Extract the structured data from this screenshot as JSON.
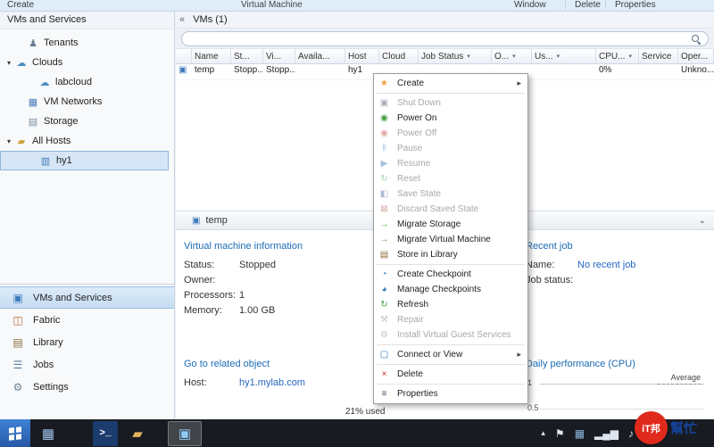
{
  "titlebar": {
    "create": "Create",
    "title": "Virtual Machine",
    "window": "Window",
    "delete": "Delete",
    "properties": "Properties"
  },
  "icons": {
    "collapse_pane": "«",
    "details_expand": "⌄",
    "tray_expand": "▴"
  },
  "sidebar": {
    "header": "VMs and Services",
    "tree": [
      {
        "label": "Tenants",
        "icon": "tenants",
        "glyph": "♟",
        "color": "#6b7f94",
        "indent": 1
      },
      {
        "label": "Clouds",
        "icon": "clouds",
        "glyph": "☁",
        "color": "#4a90c4",
        "indent": 0,
        "expander": "▾"
      },
      {
        "label": "labcloud",
        "icon": "cloud",
        "glyph": "☁",
        "color": "#4a90c4",
        "indent": 2
      },
      {
        "label": "VM Networks",
        "icon": "vm-networks",
        "glyph": "▦",
        "color": "#4a7fb5",
        "indent": 1
      },
      {
        "label": "Storage",
        "icon": "storage",
        "glyph": "▤",
        "color": "#7a8da0",
        "indent": 1
      },
      {
        "label": "All Hosts",
        "icon": "all-hosts-folder",
        "glyph": "▰",
        "color": "#c8a23c",
        "indent": 0,
        "expander": "▾"
      },
      {
        "label": "hy1",
        "icon": "host-server",
        "glyph": "▥",
        "color": "#3c7ab8",
        "indent": 2,
        "selected": true
      }
    ],
    "nav": [
      {
        "label": "VMs and Services",
        "icon": "vms-and-services",
        "glyph": "▣",
        "color": "#3c7ab8",
        "selected": true
      },
      {
        "label": "Fabric",
        "icon": "fabric",
        "glyph": "◫",
        "color": "#c06a3a"
      },
      {
        "label": "Library",
        "icon": "library",
        "glyph": "▤",
        "color": "#8a6d3b"
      },
      {
        "label": "Jobs",
        "icon": "jobs",
        "glyph": "☰",
        "color": "#5b7a9d"
      },
      {
        "label": "Settings",
        "icon": "settings",
        "glyph": "⚙",
        "color": "#6b7f94"
      }
    ]
  },
  "content": {
    "header": "VMs (1)",
    "search_value": "",
    "table": {
      "columns": [
        {
          "label": ""
        },
        {
          "label": "Name"
        },
        {
          "label": "St..."
        },
        {
          "label": "Vi..."
        },
        {
          "label": "Availa..."
        },
        {
          "label": "Host"
        },
        {
          "label": "Cloud"
        },
        {
          "label": "Job Status",
          "arrow": true
        },
        {
          "label": "O...",
          "arrow": true
        },
        {
          "label": "Us...",
          "arrow": true
        },
        {
          "label": "CPU...",
          "arrow": true
        },
        {
          "label": "Service"
        },
        {
          "label": "Oper..."
        }
      ],
      "row_cells": [
        {
          "icon": "vm",
          "glyph": "▣",
          "color": "#3c7ab8",
          "label": ""
        },
        {
          "label": "temp"
        },
        {
          "label": "Stopp..."
        },
        {
          "label": "Stopp..."
        },
        {
          "label": ""
        },
        {
          "label": "hy1"
        },
        {
          "label": ""
        },
        {
          "label": ""
        },
        {
          "label": ""
        },
        {
          "label": ""
        },
        {
          "label": "0%"
        },
        {
          "label": ""
        },
        {
          "label": "Unkno..."
        }
      ]
    },
    "details_tab": "temp",
    "vm_info": {
      "heading": "Virtual machine information",
      "fields": [
        {
          "label": "Status:",
          "value": "Stopped"
        },
        {
          "label": "Owner:",
          "value": ""
        },
        {
          "label": "Processors:",
          "value": "1"
        },
        {
          "label": "Memory:",
          "value": "1.00 GB"
        }
      ]
    },
    "related": {
      "heading": "Go to related object",
      "fields": [
        {
          "label": "Host:",
          "value": "hy1.mylab.com",
          "link": true
        }
      ]
    },
    "recent_job": {
      "heading": "Recent job",
      "fields": [
        {
          "label": "Name:",
          "value": "No recent job",
          "link": true
        },
        {
          "label": "Job status:",
          "value": ""
        }
      ]
    },
    "daily_perf": {
      "heading": "Daily performance (CPU)",
      "legend": "Average",
      "ytick_top": "1",
      "ytick_mid": "0.5"
    },
    "usage": "21% used"
  },
  "chart_data": {
    "type": "line",
    "title": "Daily performance (CPU)",
    "x": [],
    "series": [
      {
        "name": "Average",
        "values": []
      }
    ],
    "ylim": [
      0,
      1
    ],
    "yticks": [
      0.5,
      1
    ],
    "legend_position": "top-right",
    "grid": true
  },
  "context_menu": {
    "items": [
      {
        "label": "Create",
        "icon": "create-star",
        "glyph": "★",
        "color": "#f2a13a",
        "submenu": true
      },
      {
        "sep": true
      },
      {
        "label": "Shut Down",
        "icon": "shut-down",
        "glyph": "▣",
        "color": "#44506b",
        "disabled": true
      },
      {
        "label": "Power On",
        "icon": "power-on",
        "glyph": "◉",
        "color": "#3f9b3f"
      },
      {
        "label": "Power Off",
        "icon": "power-off",
        "glyph": "◉",
        "color": "#c0392b",
        "disabled": true
      },
      {
        "label": "Pause",
        "icon": "pause",
        "glyph": "‖",
        "color": "#2e75b6",
        "disabled": true
      },
      {
        "label": "Resume",
        "icon": "resume",
        "glyph": "▶",
        "color": "#2e75b6",
        "disabled": true
      },
      {
        "label": "Reset",
        "icon": "reset",
        "glyph": "↻",
        "color": "#3f9b3f",
        "disabled": true
      },
      {
        "label": "Save State",
        "icon": "save-state",
        "glyph": "◧",
        "color": "#4a6fa5",
        "disabled": true
      },
      {
        "label": "Discard Saved State",
        "icon": "discard-saved-state",
        "glyph": "⊠",
        "color": "#a33327",
        "disabled": true
      },
      {
        "label": "Migrate Storage",
        "icon": "migrate-storage",
        "glyph": "→",
        "color": "#58a54a"
      },
      {
        "label": "Migrate Virtual Machine",
        "icon": "migrate-virtual-machine",
        "glyph": "→",
        "color": "#58a54a"
      },
      {
        "label": "Store in Library",
        "icon": "store-in-library",
        "glyph": "▤",
        "color": "#8a6d3b"
      },
      {
        "sep": true
      },
      {
        "label": "Create Checkpoint",
        "icon": "create-checkpoint",
        "glyph": "◔",
        "color": "#2e75b6"
      },
      {
        "label": "Manage Checkpoints",
        "icon": "manage-checkpoints",
        "glyph": "◕",
        "color": "#2e75b6"
      },
      {
        "label": "Refresh",
        "icon": "refresh",
        "glyph": "↻",
        "color": "#3f9b3f"
      },
      {
        "label": "Repair",
        "icon": "repair",
        "glyph": "⚒",
        "color": "#777777",
        "disabled": true
      },
      {
        "label": "Install Virtual Guest Services",
        "icon": "install-virtual-guest-services",
        "glyph": "⚙",
        "color": "#6a8f6a",
        "disabled": true
      },
      {
        "sep": true
      },
      {
        "label": "Connect or View",
        "icon": "connect-or-view",
        "glyph": "▢",
        "color": "#2e75b6",
        "submenu": true
      },
      {
        "sep": true
      },
      {
        "label": "Delete",
        "icon": "delete",
        "glyph": "×",
        "color": "#cc2222"
      },
      {
        "sep": true
      },
      {
        "label": "Properties",
        "icon": "properties",
        "glyph": "≡",
        "color": "#44506b"
      }
    ]
  },
  "taskbar": {
    "apps": [
      {
        "icon": "server-manager",
        "glyph": "▦",
        "color": "#9fc3e8"
      },
      {
        "icon": "powershell",
        "glyph": ">_",
        "color": "#ffffff",
        "bg": "#1c3b6e",
        "ps": true
      },
      {
        "icon": "file-explorer",
        "glyph": "▰",
        "color": "#e3b35c"
      },
      {
        "icon": "vmm-console",
        "glyph": "▣",
        "color": "#8ecaf5",
        "active": true
      }
    ],
    "tray": [
      {
        "icon": "notification-flag",
        "glyph": "⚑",
        "color": "#dfe5ee"
      },
      {
        "icon": "server-status",
        "glyph": "▦",
        "color": "#8fb8e0"
      },
      {
        "icon": "network",
        "glyph": "▂▄▆",
        "color": "#dfe5ee"
      },
      {
        "icon": "volume",
        "glyph": "♪",
        "color": "#dfe5ee"
      }
    ]
  },
  "watermark": {
    "badge": "iT邦",
    "side": "幫忙"
  }
}
